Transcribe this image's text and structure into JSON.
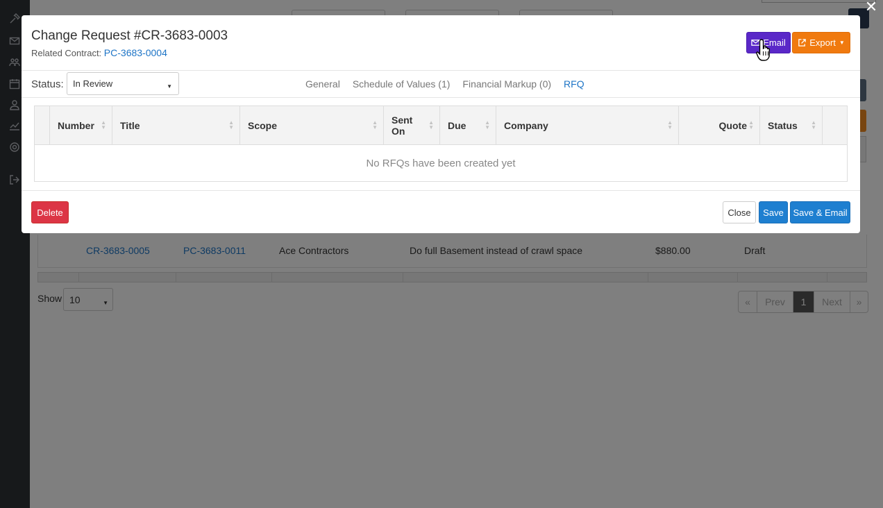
{
  "background": {
    "row": {
      "number": "CR-3683-0005",
      "contract": "PC-3683-0011",
      "company": "Ace Contractors",
      "title": "Do full Basement instead of crawl space",
      "amount": "$880.00",
      "status": "Draft"
    },
    "show_label": "Show",
    "show_value": "10",
    "pager": {
      "first": "«",
      "prev": "Prev",
      "page": "1",
      "next": "Next",
      "last": "»"
    }
  },
  "overlay": {
    "close_glyph": "✕"
  },
  "modal": {
    "title": "Change Request #CR-3683-0003",
    "related_label": "Related Contract:",
    "related_value": "PC-3683-0004",
    "email_label": "Email",
    "export_label": "Export",
    "status_label": "Status:",
    "status_value": "In Review",
    "tabs": [
      {
        "label": "General"
      },
      {
        "label": "Schedule of Values (1)"
      },
      {
        "label": "Financial Markup (0)"
      },
      {
        "label": "RFQ"
      }
    ],
    "active_tab": "RFQ",
    "columns": [
      "Number",
      "Title",
      "Scope",
      "Sent On",
      "Due",
      "Company",
      "Quote",
      "Status"
    ],
    "sent_on_line1": "Sent",
    "sent_on_line2": "On",
    "empty_message": "No RFQs have been created yet",
    "footer": {
      "delete_label": "Delete",
      "close_label": "Close",
      "save_label": "Save",
      "save_email_label": "Save & Email"
    }
  },
  "colors": {
    "email_button": "#5a28c8",
    "export_button": "#f07a0f",
    "delete_button": "#dc3545",
    "save_button": "#1e7fd0",
    "link": "#1d74c6"
  }
}
